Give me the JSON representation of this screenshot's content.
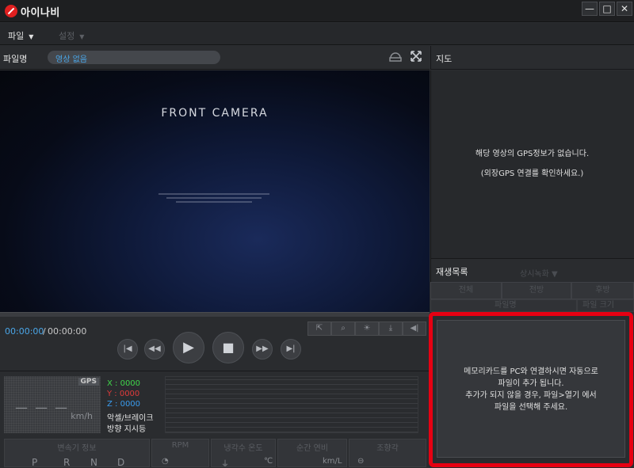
{
  "app": {
    "title": "아이나비"
  },
  "window": {
    "minimize": "—",
    "maximize": "□",
    "close": "✕"
  },
  "menu": [
    {
      "label": "파일",
      "caret": "▼"
    },
    {
      "label": "설정",
      "caret": "▼"
    }
  ],
  "file": {
    "label": "파일명",
    "value": "영상 없음"
  },
  "video": {
    "title": "FRONT CAMERA",
    "current_time": "00:00:00",
    "separator": "/",
    "total_time": "00:00:00"
  },
  "gps": {
    "badge": "GPS",
    "speed_placeholder": "— — —",
    "speed_unit": "km/h",
    "x": "X : 0000",
    "y": "Y : 0000",
    "z": "Z : 0000",
    "accel_brake": "악셀/브레이크",
    "direction": "방향 지시등"
  },
  "stats": {
    "gear_header": "변속기 정보",
    "gears": [
      "P",
      "R",
      "N",
      "D"
    ],
    "rpm_header": "RPM",
    "coolant_header": "냉각수 온도",
    "coolant_unit": "℃",
    "fuel_header": "순간 연비",
    "fuel_unit": "km/L",
    "steering_header": "조향각"
  },
  "map": {
    "title": "지도",
    "message1": "해당 영상의 GPS정보가 없습니다.",
    "message2": "(외장GPS 연결를 확인하세요.)"
  },
  "playlist": {
    "title": "재생목록",
    "sort": "상시녹화",
    "tabs": [
      "전체",
      "전방",
      "후방"
    ],
    "columns": [
      "파일명",
      "파일 크기"
    ],
    "notice_line1": "메모리카드를 PC와 연결하시면 자동으로",
    "notice_line2": "파일이 추가 됩니다.",
    "notice_line3": "추가가 되지 않을 경우, 파일>열기 에서",
    "notice_line4": "파일을 선택해 주세요."
  },
  "colors": {
    "accent_blue": "#4aa6e8",
    "highlight_red": "#e60012",
    "x_green": "#3fd64a",
    "y_red": "#e03a3a",
    "z_blue": "#3a9cf0"
  }
}
